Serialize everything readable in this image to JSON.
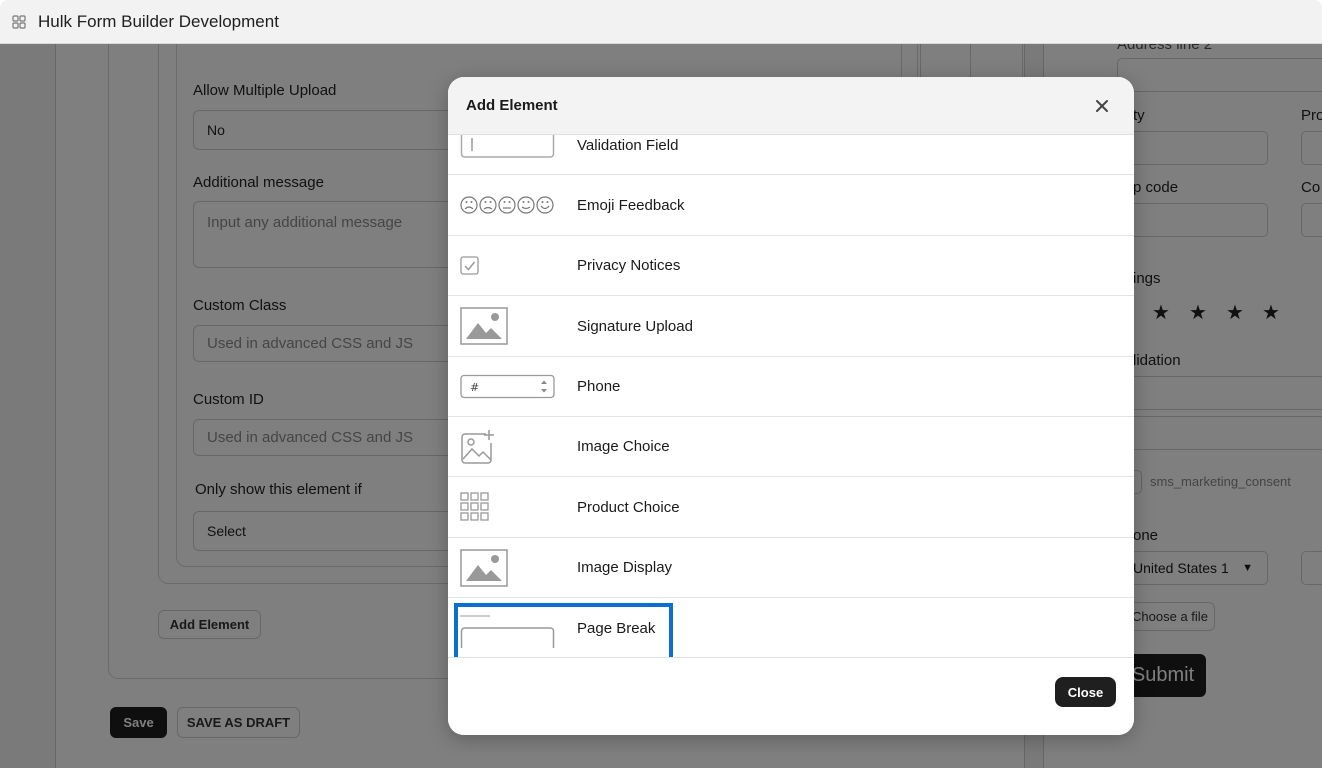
{
  "window": {
    "title": "Hulk Form Builder Development",
    "icon": "app-grid-icon"
  },
  "background_form": {
    "cutoff_label": "Allow Multiple Upload",
    "allow_multiple_upload": {
      "label": "Allow Multiple Upload",
      "value": "No"
    },
    "additional_message": {
      "label": "Additional message",
      "placeholder": "Input any additional message"
    },
    "custom_class": {
      "label": "Custom Class",
      "placeholder": "Used in advanced CSS and JS"
    },
    "custom_id": {
      "label": "Custom ID",
      "placeholder": "Used in advanced CSS and JS"
    },
    "conditional": {
      "label": "Only show this element if",
      "value": "Select"
    },
    "add_element_button": "Add Element",
    "save_button": "Save",
    "save_draft_button": "SAVE AS DRAFT"
  },
  "preview": {
    "address_line_2": "Address line 2",
    "city_partial": "ty",
    "province_partial": "Pro",
    "zip_partial": "p code",
    "country_partial": "Co",
    "ratings_partial": "ings",
    "validation_partial": "lidation",
    "sms_consent": "sms_marketing_consent",
    "phone_partial": "one",
    "country_select": "United States 1",
    "choose_file": "Choose a file",
    "submit": "Submit"
  },
  "modal": {
    "title": "Add Element",
    "close_label": "Close",
    "elements": [
      {
        "label": "Validation Field",
        "icon": "input-field-icon"
      },
      {
        "label": "Emoji Feedback",
        "icon": "emoji-faces-icon"
      },
      {
        "label": "Privacy Notices",
        "icon": "checkbox-icon"
      },
      {
        "label": "Signature Upload",
        "icon": "image-icon"
      },
      {
        "label": "Phone",
        "icon": "number-input-icon",
        "thumb_text": "#"
      },
      {
        "label": "Image Choice",
        "icon": "image-add-icon"
      },
      {
        "label": "Product Choice",
        "icon": "grid-icon"
      },
      {
        "label": "Image Display",
        "icon": "image-icon"
      },
      {
        "label": "Page Break",
        "icon": "page-break-icon",
        "highlighted": true
      }
    ]
  },
  "colors": {
    "highlight": "#0a6fd1",
    "primary_button": "#1f1f1f"
  }
}
